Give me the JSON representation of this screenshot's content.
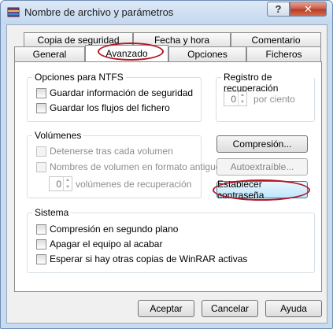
{
  "window": {
    "title": "Nombre de archivo y parámetros",
    "help_label": "?",
    "close_label": "✕"
  },
  "tabs": {
    "row1": [
      "Copia de seguridad",
      "Fecha y hora",
      "Comentario"
    ],
    "row2": [
      "General",
      "Avanzado",
      "Opciones",
      "Ficheros"
    ],
    "active": "Avanzado"
  },
  "ntfs": {
    "title": "Opciones para NTFS",
    "items": [
      "Guardar información de seguridad",
      "Guardar los flujos del fichero"
    ]
  },
  "recovery_log": {
    "title": "Registro de recuperación",
    "value": "0",
    "unit": "por ciento"
  },
  "volumes": {
    "title": "Volúmenes",
    "items": [
      "Detenerse tras cada volumen",
      "Nombres de volumen en formato antiguo"
    ],
    "recovery_value": "0",
    "recovery_label": "volúmenes de recuperación"
  },
  "side_buttons": {
    "compression": "Compresión...",
    "sfx": "Autoextraíble...",
    "password": "Establecer contraseña"
  },
  "system": {
    "title": "Sistema",
    "items": [
      "Compresión en segundo plano",
      "Apagar el equipo al acabar",
      "Esperar si hay otras copias de WinRAR activas"
    ]
  },
  "footer": {
    "accept": "Aceptar",
    "cancel": "Cancelar",
    "help": "Ayuda"
  },
  "colors": {
    "highlight_ellipse": "#b01822",
    "close_button": "#c85a43"
  }
}
